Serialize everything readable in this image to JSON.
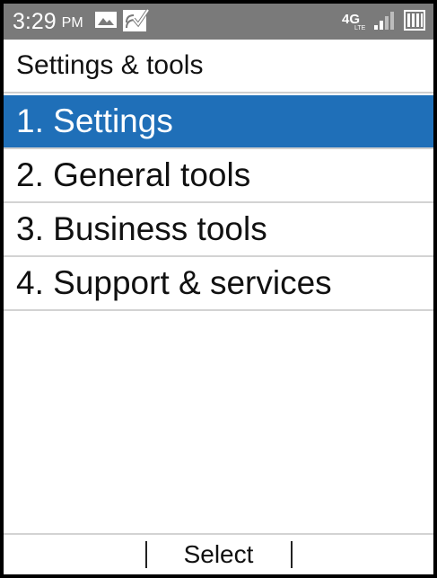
{
  "status_bar": {
    "time": "3:29",
    "ampm": "PM",
    "left_icons": [
      "image-icon",
      "wifi-calling-icon"
    ],
    "right_icons": [
      "4g-lte-icon",
      "signal-icon",
      "battery-icon"
    ],
    "background": "#7a7a7a"
  },
  "header": {
    "title": "Settings & tools"
  },
  "menu": {
    "items": [
      {
        "label": "1. Settings",
        "selected": true
      },
      {
        "label": "2. General tools",
        "selected": false
      },
      {
        "label": "3. Business tools",
        "selected": false
      },
      {
        "label": "4. Support & services",
        "selected": false
      }
    ],
    "highlight_color": "#1f6fb8"
  },
  "softkeys": {
    "left": "",
    "center": "Select",
    "right": ""
  }
}
